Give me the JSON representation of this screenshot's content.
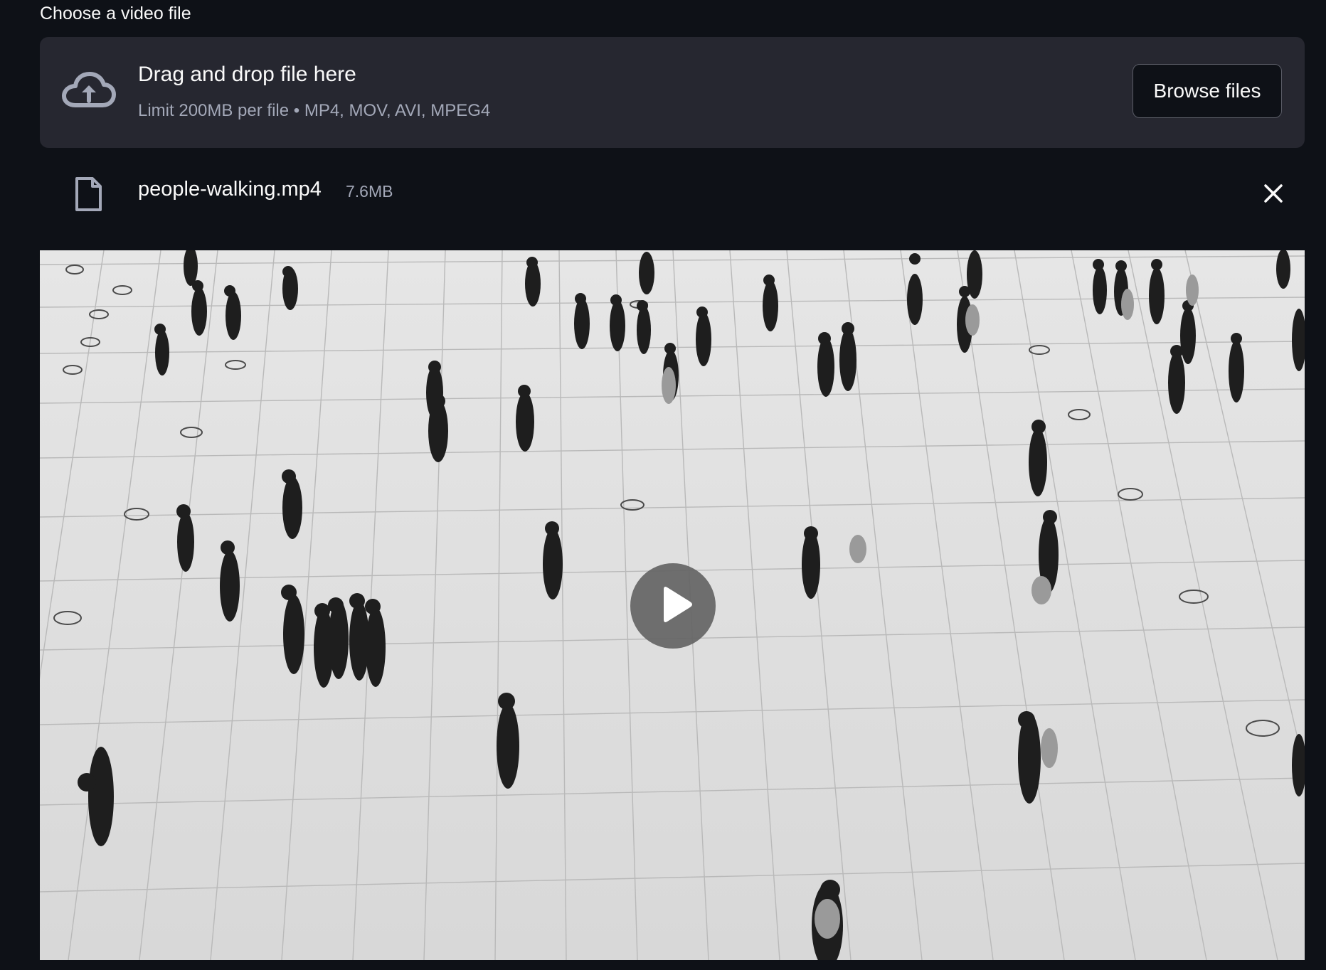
{
  "uploader": {
    "label": "Choose a video file",
    "dropzone_title": "Drag and drop file here",
    "dropzone_subtitle": "Limit 200MB per file • MP4, MOV, AVI, MPEG4",
    "browse_label": "Browse files",
    "upload_icon": "cloud-upload-icon"
  },
  "file": {
    "name": "people-walking.mp4",
    "size": "7.6MB",
    "icon": "file-icon",
    "remove_icon": "close-icon"
  },
  "video": {
    "content": "grayscale aerial view of people walking on a tiled floor",
    "play_icon": "play-icon"
  },
  "colors": {
    "background": "#0e1117",
    "dropzone": "#262730",
    "text": "#fafafa",
    "muted_text": "#a3a8b8",
    "button_border": "#5a5c66"
  }
}
